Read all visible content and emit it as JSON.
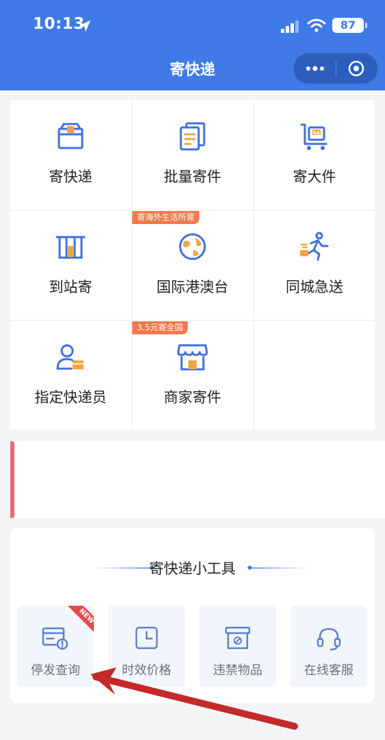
{
  "status_bar": {
    "time": "10:13",
    "battery": "87"
  },
  "nav": {
    "title": "寄快递"
  },
  "services": [
    {
      "label": "寄快递",
      "icon": "package-box-icon",
      "badge": ""
    },
    {
      "label": "批量寄件",
      "icon": "batch-documents-icon",
      "badge": ""
    },
    {
      "label": "寄大件",
      "icon": "cart-kg-icon",
      "badge": ""
    },
    {
      "label": "到站寄",
      "icon": "station-icon",
      "badge": ""
    },
    {
      "label": "国际港澳台",
      "icon": "globe-icon",
      "badge": "寄海外生活所需"
    },
    {
      "label": "同城急送",
      "icon": "runner-icon",
      "badge": ""
    },
    {
      "label": "指定快递员",
      "icon": "courier-person-icon",
      "badge": ""
    },
    {
      "label": "商家寄件",
      "icon": "storefront-icon",
      "badge": "3.5元寄全国"
    }
  ],
  "tools": {
    "title": "寄快递小工具",
    "items": [
      {
        "label": "停发查询",
        "icon": "suspension-query-icon",
        "ribbon": "NEW"
      },
      {
        "label": "时效价格",
        "icon": "clock-icon",
        "ribbon": ""
      },
      {
        "label": "违禁物品",
        "icon": "prohibited-box-icon",
        "ribbon": ""
      },
      {
        "label": "在线客服",
        "icon": "headset-icon",
        "ribbon": ""
      }
    ]
  },
  "colors": {
    "brand": "#3f7ae6",
    "icon_orange": "#f2a640",
    "promo": "#f2784b",
    "annotation_arrow": "#c42a2a"
  }
}
